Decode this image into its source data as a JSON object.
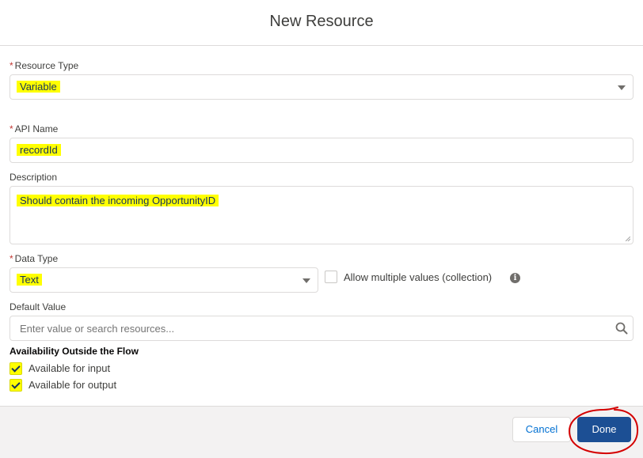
{
  "header": {
    "title": "New Resource"
  },
  "resource_type": {
    "label": "Resource Type",
    "required_marker": "*",
    "value": "Variable"
  },
  "api_name": {
    "label": "API Name",
    "required_marker": "*",
    "value": "recordId"
  },
  "description": {
    "label": "Description",
    "value": "Should contain the incoming OpportunityID"
  },
  "data_type": {
    "label": "Data Type",
    "required_marker": "*",
    "value": "Text"
  },
  "collection": {
    "label": "Allow multiple values (collection)",
    "checked": false,
    "info_glyph": "i"
  },
  "default_value": {
    "label": "Default Value",
    "placeholder": "Enter value or search resources..."
  },
  "availability": {
    "title": "Availability Outside the Flow",
    "input": {
      "label": "Available for input",
      "checked": true
    },
    "output": {
      "label": "Available for output",
      "checked": true
    }
  },
  "footer": {
    "cancel_label": "Cancel",
    "done_label": "Done"
  },
  "colors": {
    "highlight": "#ffff00",
    "brand_button": "#1c4f94",
    "required": "#c23934",
    "annotation": "#d40000"
  },
  "icons": {
    "dropdown": "chevron-down-icon",
    "search": "search-icon",
    "info": "info-icon",
    "check": "check-icon"
  }
}
